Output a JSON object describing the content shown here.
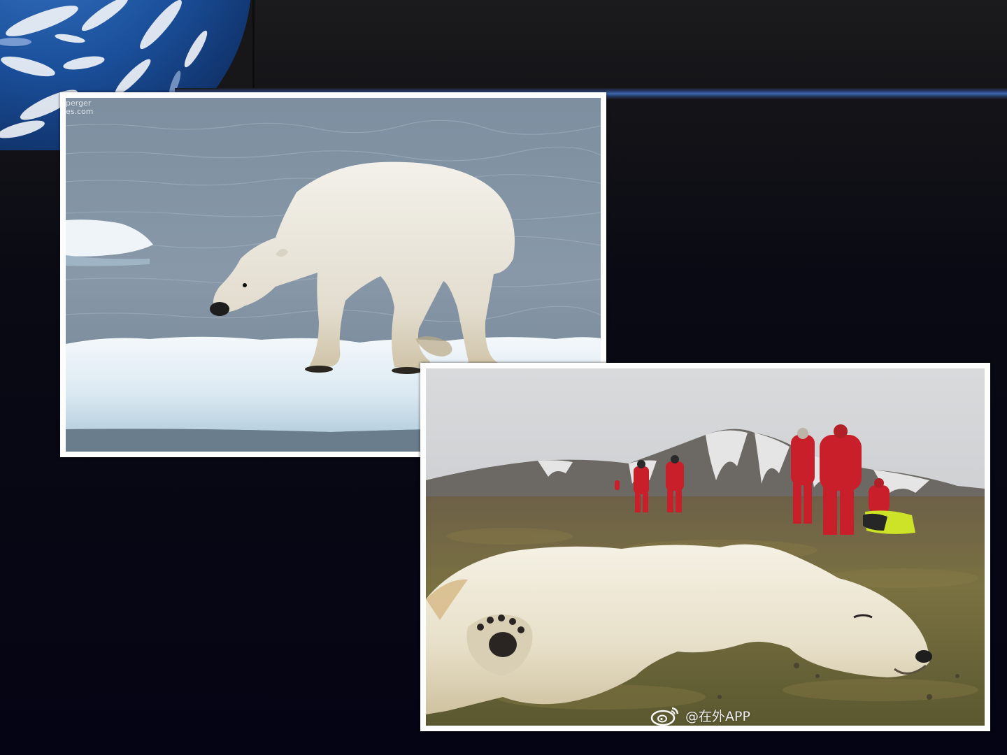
{
  "slide": {
    "background_color": "#040414",
    "band_color": "#3d6ab0"
  },
  "decorations": {
    "earth": "earth-globe-image",
    "top_band": "blue-gradient-line"
  },
  "photos": [
    {
      "subject": "polar-bear-on-ice",
      "watermark": "perger\nes.com"
    },
    {
      "subject": "polar-bear-on-tundra",
      "watermark_icon": "weibo-icon",
      "watermark": "@在外APP"
    }
  ]
}
